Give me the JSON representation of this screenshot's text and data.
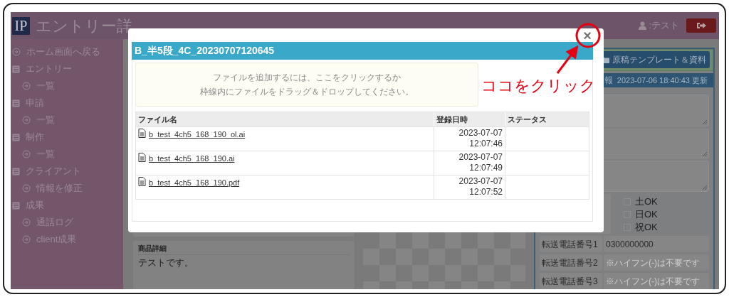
{
  "header": {
    "logo": "IP",
    "title": "エントリー詳",
    "user": ":テスト"
  },
  "sidebar": {
    "items": [
      {
        "kind": "link",
        "label": "ホーム画面へ戻る"
      },
      {
        "kind": "section",
        "label": "エントリー",
        "children": [
          {
            "label": "一覧"
          }
        ]
      },
      {
        "kind": "section",
        "label": "申請",
        "children": [
          {
            "label": "一覧"
          }
        ]
      },
      {
        "kind": "section",
        "label": "制作",
        "children": [
          {
            "label": "一覧"
          }
        ]
      },
      {
        "kind": "section",
        "label": "クライアント",
        "children": [
          {
            "label": "情報を修正"
          }
        ]
      },
      {
        "kind": "section",
        "label": "成果",
        "children": [
          {
            "label": "通話ログ"
          },
          {
            "label": "client成果"
          }
        ]
      }
    ]
  },
  "detail": {
    "label": "商品詳細",
    "text": "テストです。"
  },
  "right_panel": {
    "button": "原稿テンプレート＆資料",
    "header": "報",
    "updated": "2023-07-06 18:40:43 更新",
    "checkboxes": [
      {
        "label": "土OK",
        "checked": false
      },
      {
        "label": "日OK",
        "checked": false
      },
      {
        "label": "祝OK",
        "checked": false
      }
    ],
    "phones": [
      {
        "label": "転送電話番号1",
        "value": "0300000000"
      },
      {
        "label": "転送電話番号2",
        "placeholder": "※ハイフン(-)は不要です"
      },
      {
        "label": "転送電話番号3",
        "placeholder": "※ハイフン(-)は不要です"
      }
    ]
  },
  "modal": {
    "title": "B_半5段_4C_20230707120645",
    "close": "×",
    "dropzone": [
      "ファイルを追加するには、ここをクリックするか",
      "枠線内にファイルをドラッグ＆ドロップしてください。"
    ],
    "table": {
      "columns": [
        "ファイル名",
        "登録日時",
        "ステータス"
      ],
      "rows": [
        {
          "file": "b_test_4ch5_168_190_ol.ai",
          "registered": "2023-07-07 12:07:46"
        },
        {
          "file": "b_test_4ch5_168_190.ai",
          "registered": "2023-07-07 12:07:49"
        },
        {
          "file": "b_test_4ch5_168_190.pdf",
          "registered": "2023-07-07 12:07:52"
        }
      ]
    }
  },
  "annotation": {
    "text": "ココをクリック"
  }
}
